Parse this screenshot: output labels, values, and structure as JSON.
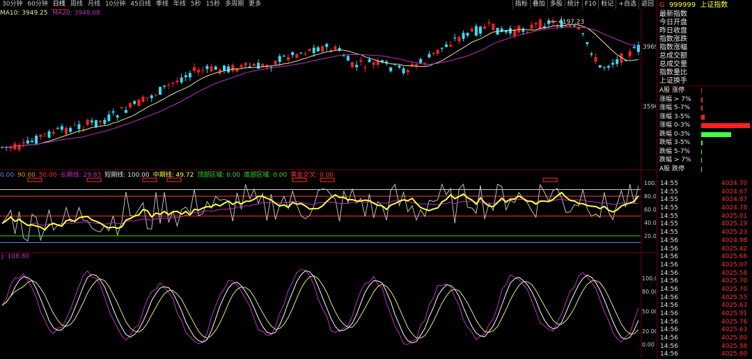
{
  "toolbar": {
    "periods": [
      "30分钟",
      "60分钟",
      "日线",
      "周线",
      "月线",
      "10分钟",
      "45日线",
      "季线",
      "年线",
      "5秒",
      "15秒",
      "多周期",
      "更多"
    ],
    "active_period": "日线",
    "tools": [
      "指标",
      "叠加",
      "多股",
      "统计",
      "F10",
      "标记",
      "+自选",
      "返回"
    ]
  },
  "main_pane": {
    "ma10_label": "MA10: 3949.25",
    "ma20_label": "MA20: 3948.08",
    "high_annotation": "4197.23",
    "price_ticks": [
      "3969",
      "3590"
    ],
    "colors": {
      "up": "#ff2020",
      "down": "#30e0ff",
      "ma10": "#e8e8a0",
      "ma20": "#c030c0"
    }
  },
  "indicator_pane": {
    "labels": [
      {
        "text": "0.00",
        "color": "#6080ff"
      },
      {
        "text": "90.00",
        "color": "#d0a000"
      },
      {
        "text": "50.00",
        "color": "#ff3030"
      },
      {
        "text": "长期线: 29.83",
        "color": "#c030c0"
      },
      {
        "text": "短期线: 100.00",
        "color": "#e0e0e0"
      },
      {
        "text": "中期线: 49.72",
        "color": "#ffff40"
      },
      {
        "text": "顶部区域: 0.00",
        "color": "#30e030"
      },
      {
        "text": "底部区域: 0.00",
        "color": "#30e030"
      },
      {
        "text": "黄金交叉: 0.00",
        "color": "#ff3030"
      }
    ],
    "axis": [
      "100.0",
      "80.00",
      "60.00",
      "40.00",
      "20.00"
    ]
  },
  "kdj_pane": {
    "label": "J: 108.80",
    "axis": [
      "100.00",
      "80.00",
      "50.00",
      "20.00",
      "0.00"
    ]
  },
  "side_panel": {
    "header_marker": "G",
    "code": "999999",
    "name": "上证指数",
    "menu": [
      "最新指数",
      "今日开盘",
      "昨日收盘",
      "指数涨跌",
      "指数涨幅",
      "总成交额",
      "总成交量",
      "指数量比",
      "上证换手"
    ],
    "distribution": [
      {
        "label": "A股 涨停",
        "value": 0.02,
        "color": "#ff2020"
      },
      {
        "label": "涨幅 > 7%",
        "value": 0.03,
        "color": "#ff2020"
      },
      {
        "label": "涨幅 5-7%",
        "value": 0.03,
        "color": "#ff2020"
      },
      {
        "label": "涨幅 3-5%",
        "value": 0.07,
        "color": "#ff2020"
      },
      {
        "label": "涨幅 0-3%",
        "value": 1.0,
        "color": "#ff2020"
      },
      {
        "label": "跌幅 0-3%",
        "value": 0.62,
        "color": "#40ff40"
      },
      {
        "label": "跌幅 3-5%",
        "value": 0.03,
        "color": "#40ff40"
      },
      {
        "label": "跌幅 5-7%",
        "value": 0.01,
        "color": "#40ff40"
      },
      {
        "label": "跌幅 > 7%",
        "value": 0.01,
        "color": "#40ff40"
      },
      {
        "label": "A股 跌停",
        "value": 0.01,
        "color": "#40ff40"
      }
    ],
    "ticks": [
      {
        "time": "14:55",
        "price": "4024.70"
      },
      {
        "time": "14:55",
        "price": "4024.67"
      },
      {
        "time": "14:55",
        "price": "4024.87"
      },
      {
        "time": "14:55",
        "price": "4024.78"
      },
      {
        "time": "14:55",
        "price": "4025.01"
      },
      {
        "time": "14:55",
        "price": "4025.19"
      },
      {
        "time": "14:55",
        "price": "4025.23"
      },
      {
        "time": "14:56",
        "price": "4024.98"
      },
      {
        "time": "14:56",
        "price": "4025.42"
      },
      {
        "time": "14:56",
        "price": "4025.66"
      },
      {
        "time": "14:56",
        "price": "4025.07"
      },
      {
        "time": "14:56",
        "price": "4025.58"
      },
      {
        "time": "14:56",
        "price": "4025.70"
      },
      {
        "time": "14:56",
        "price": "4025.70"
      },
      {
        "time": "14:56",
        "price": "4025.55"
      },
      {
        "time": "14:56",
        "price": "4025.63"
      },
      {
        "time": "14:56",
        "price": "4025.91"
      },
      {
        "time": "14:56",
        "price": "4025.76"
      },
      {
        "time": "14:56",
        "price": "4025.63"
      },
      {
        "time": "14:56",
        "price": "4025.80"
      },
      {
        "time": "14:56",
        "price": "4025.58"
      },
      {
        "time": "14:56",
        "price": "4025.80"
      }
    ]
  }
}
